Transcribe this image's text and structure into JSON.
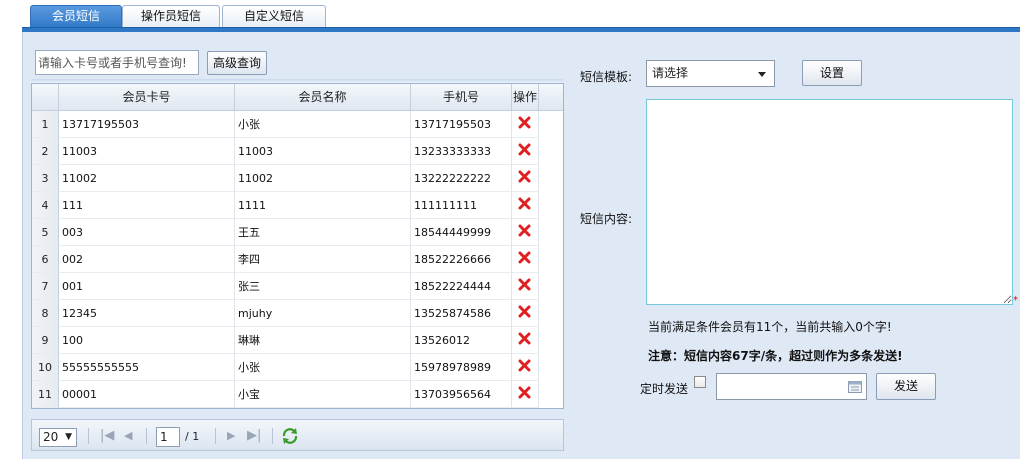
{
  "tabs": [
    {
      "label": "会员短信",
      "active": true
    },
    {
      "label": "操作员短信",
      "active": false
    },
    {
      "label": "自定义短信",
      "active": false
    }
  ],
  "search": {
    "placeholder": "请输入卡号或者手机号查询!",
    "advanced_button": "高级查询"
  },
  "grid": {
    "columns": [
      "会员卡号",
      "会员名称",
      "手机号",
      "操作"
    ],
    "rows": [
      {
        "num": "1",
        "card": "13717195503",
        "name": "小张",
        "phone": "13717195503"
      },
      {
        "num": "2",
        "card": "11003",
        "name": "11003",
        "phone": "13233333333"
      },
      {
        "num": "3",
        "card": "11002",
        "name": "11002",
        "phone": "13222222222"
      },
      {
        "num": "4",
        "card": "111",
        "name": "1111",
        "phone": "111111111"
      },
      {
        "num": "5",
        "card": "003",
        "name": "王五",
        "phone": "18544449999"
      },
      {
        "num": "6",
        "card": "002",
        "name": "李四",
        "phone": "18522226666"
      },
      {
        "num": "7",
        "card": "001",
        "name": "张三",
        "phone": "18522224444"
      },
      {
        "num": "8",
        "card": "12345",
        "name": "mjuhy",
        "phone": "13525874586"
      },
      {
        "num": "9",
        "card": "100",
        "name": "琳琳",
        "phone": "13526012"
      },
      {
        "num": "10",
        "card": "55555555555",
        "name": "小张",
        "phone": "15978978989"
      },
      {
        "num": "11",
        "card": "00001",
        "name": "小宝",
        "phone": "13703956564"
      }
    ]
  },
  "pager": {
    "page_size": "20",
    "current_page": "1",
    "total_pages": "/ 1"
  },
  "form": {
    "template_label": "短信模板:",
    "template_value": "请选择",
    "set_button": "设置",
    "content_label": "短信内容:",
    "required_mark": "*",
    "info_text": "当前满足条件会员有11个，当前共输入0个字!",
    "warning_text": "注意：短信内容67字/条，超过则作为多条发送!",
    "schedule_label": "定时发送",
    "send_button": "发送"
  },
  "colors": {
    "tab_active": "#2e78c5",
    "panel_bg": "#dfe9f6",
    "delete_icon": "#e02020"
  },
  "icons": {
    "delete": "delete-x-icon",
    "first": "first-page-icon",
    "prev": "prev-page-icon",
    "next": "next-page-icon",
    "last": "last-page-icon",
    "refresh": "refresh-icon",
    "calendar": "calendar-icon"
  }
}
